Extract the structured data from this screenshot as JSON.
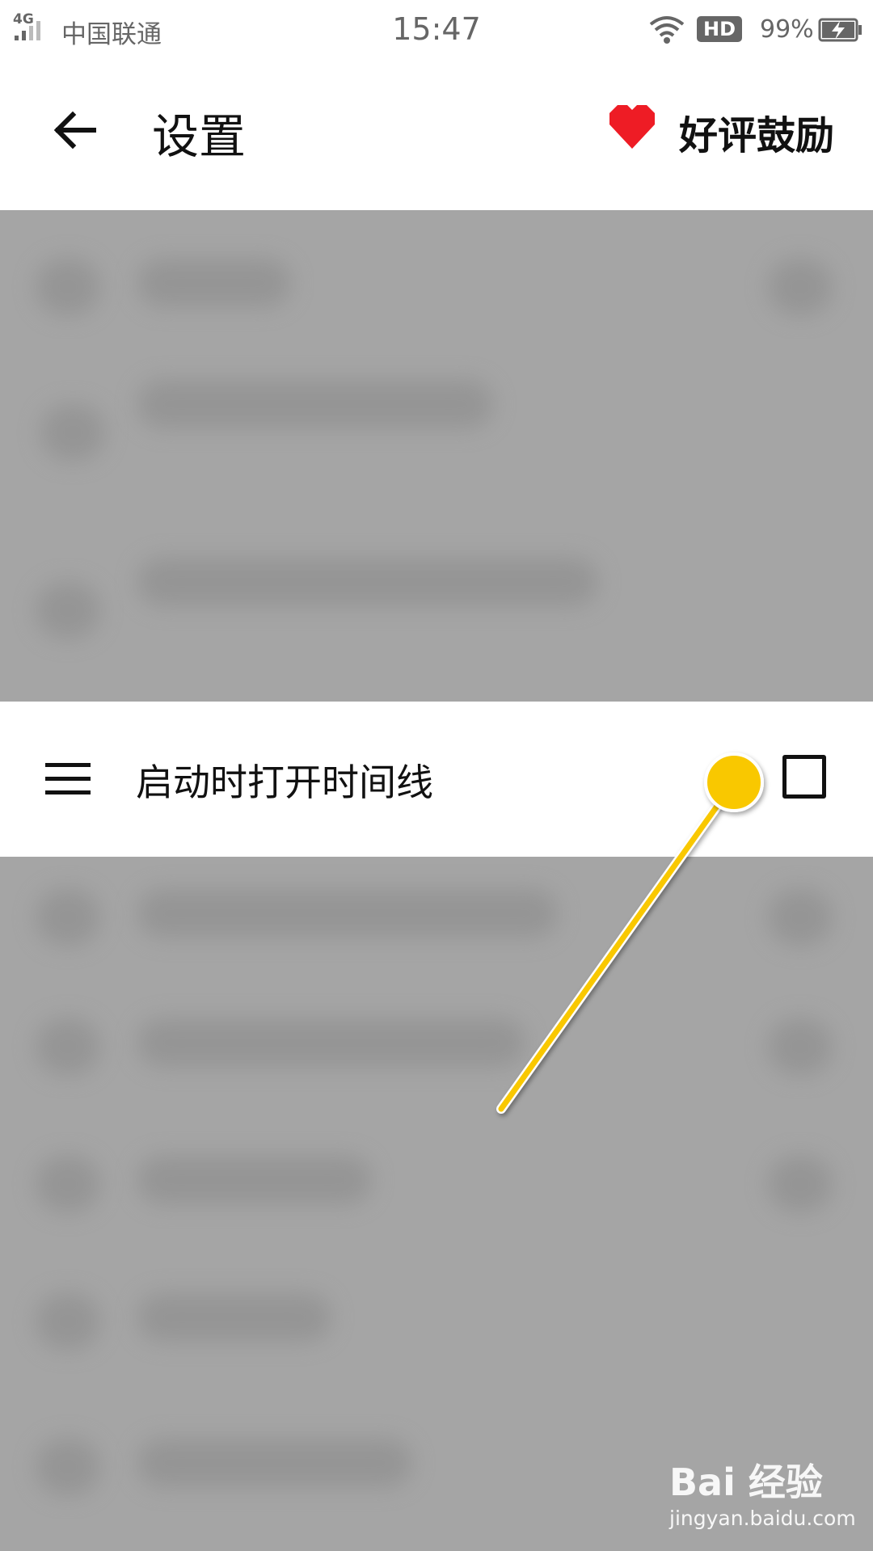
{
  "status_bar": {
    "network": "4G",
    "carrier": "中国联通",
    "time": "15:47",
    "hd_badge": "HD",
    "battery_percent": "99%",
    "icons": [
      "signal-icon",
      "wifi-icon",
      "battery-charging-icon"
    ]
  },
  "toolbar": {
    "title": "设置",
    "back_icon": "arrow-left-icon",
    "praise_icon": "heart-icon",
    "praise_label": "好评鼓励",
    "accent_color": "#ee1c25"
  },
  "setting": {
    "icon": "menu-icon",
    "label": "启动时打开时间线",
    "checked": false
  },
  "annotation": {
    "color": "#f9c800"
  },
  "watermark": {
    "brand": "Bai 经验",
    "url": "jingyan.baidu.com"
  }
}
